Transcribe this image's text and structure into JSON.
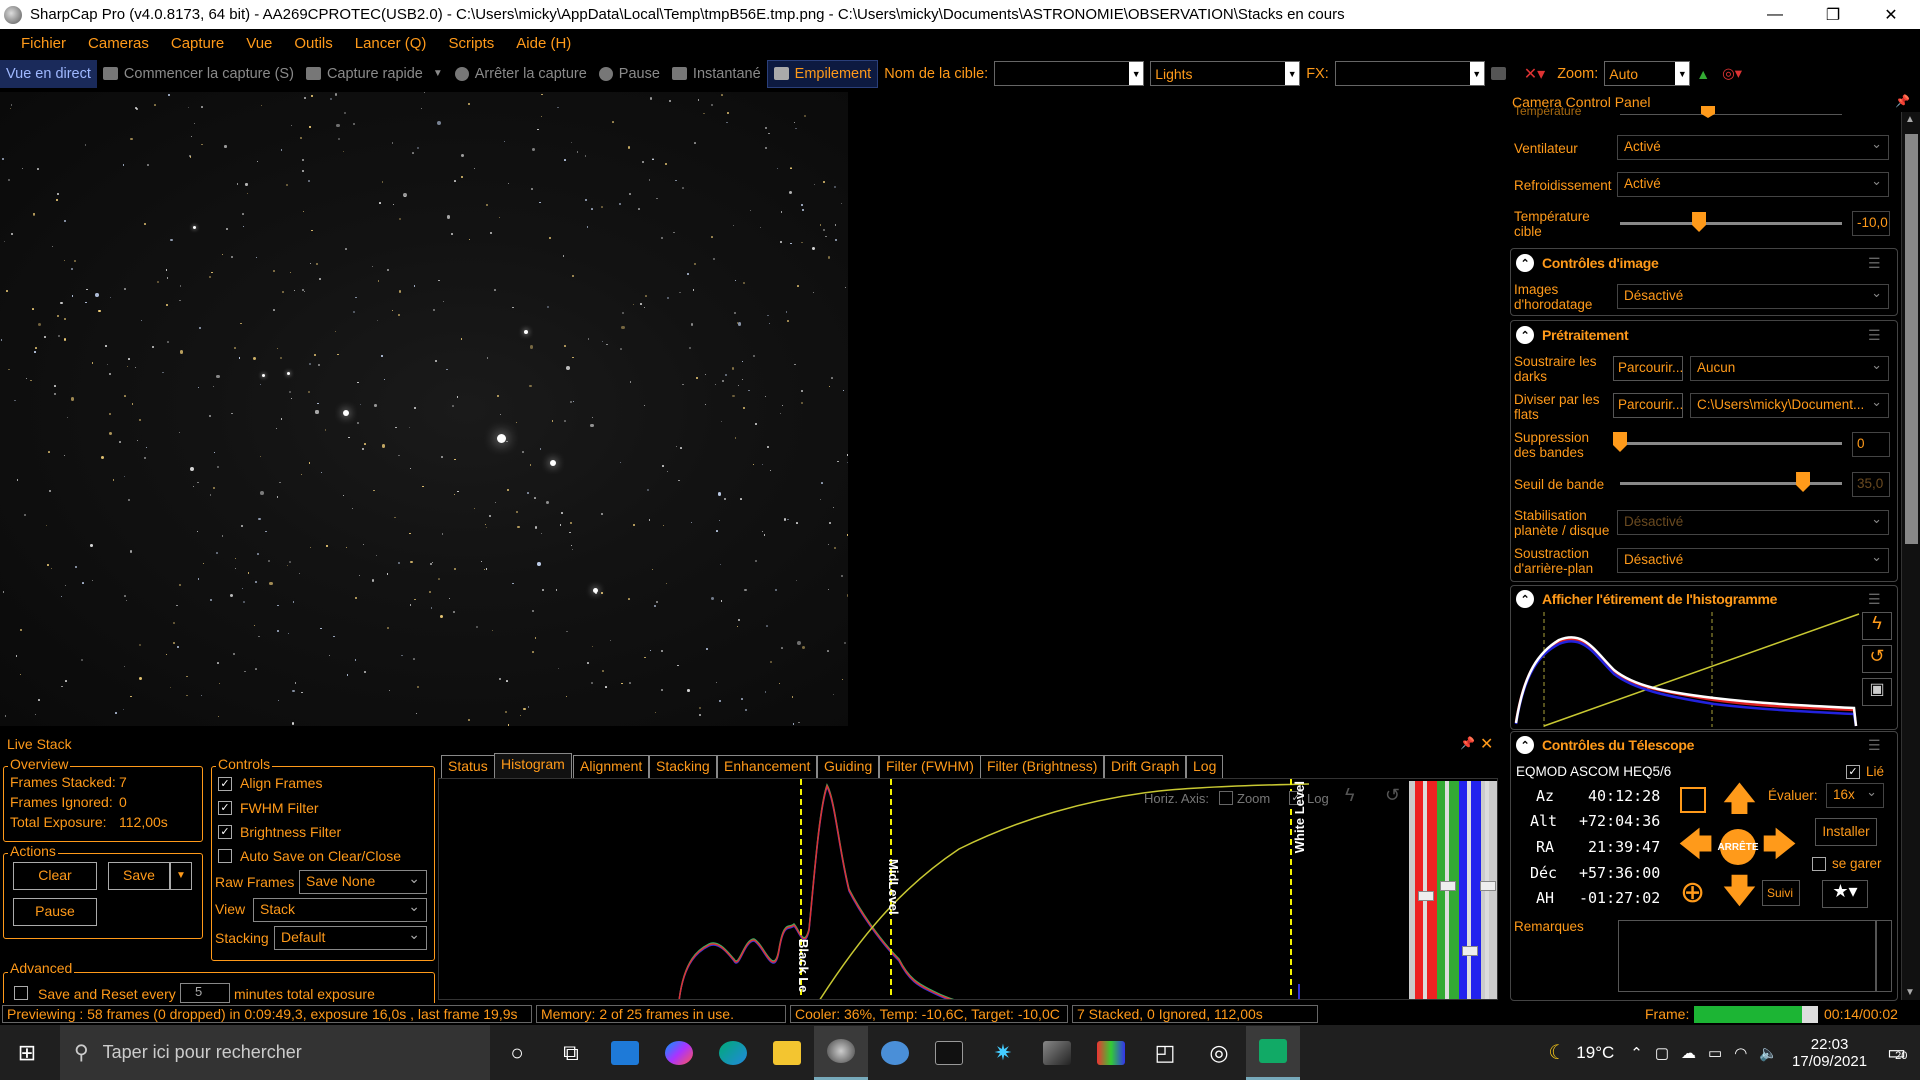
{
  "window": {
    "title": "SharpCap Pro (v4.0.8173, 64 bit) - AA269CPROTEC(USB2.0) - C:\\Users\\micky\\AppData\\Local\\Temp\\tmpB56E.tmp.png - C:\\Users\\micky\\Documents\\ASTRONOMIE\\OBSERVATION\\Stacks en cours",
    "minimize": "—",
    "restore": "❐",
    "close": "✕"
  },
  "menu": [
    "Fichier",
    "Cameras",
    "Capture",
    "Vue",
    "Outils",
    "Lancer (Q)",
    "Scripts",
    "Aide (H)"
  ],
  "toolbar": {
    "live_view": "Vue en direct",
    "start_capture": "Commencer la capture (S)",
    "quick_capture": "Capture rapide",
    "stop_capture": "Arrêter la capture",
    "pause": "Pause",
    "snapshot": "Instantané",
    "stacking": "Empilement",
    "target_label": "Nom de la cible:",
    "target_value": "",
    "frame_type": "Lights",
    "fx_label": "FX:",
    "fx_value": "",
    "zoom_label": "Zoom:",
    "zoom_value": "Auto"
  },
  "camera_panel": {
    "title": "Camera Control Panel",
    "temperature_label": "Température",
    "fan_label": "Ventilateur",
    "fan_value": "Activé",
    "cooling_label": "Refroidissement",
    "cooling_value": "Activé",
    "target_temp_label_1": "Température",
    "target_temp_label_2": "cible",
    "target_temp_value": "-10,0",
    "target_temp_level": 0.38,
    "image_controls": {
      "title": "Contrôles d'image",
      "timestamp_label_1": "Images",
      "timestamp_label_2": "d'horodatage",
      "timestamp_value": "Désactivé"
    },
    "preprocessing": {
      "title": "Prétraitement",
      "darks_label_1": "Soustraire les",
      "darks_label_2": "darks",
      "darks_browse": "Parcourir...",
      "darks_value": "Aucun",
      "flats_label_1": "Diviser par les",
      "flats_label_2": "flats",
      "flats_browse": "Parcourir...",
      "flats_value": "C:\\Users\\micky\\Document...",
      "banding_label_1": "Suppression",
      "banding_label_2": "des bandes",
      "banding_value": "0",
      "banding_level": 0.0,
      "band_threshold_label": "Seuil de bande",
      "band_threshold_value": "35,0",
      "band_threshold_level": 0.88,
      "stabilization_label_1": "Stabilisation",
      "stabilization_label_2": "planète / disque",
      "stabilization_value": "Désactivé",
      "background_label_1": "Soustraction",
      "background_label_2": "d'arrière-plan",
      "background_value": "Désactivé"
    },
    "histogram_stretch": {
      "title": "Afficher l'étirement de l'histogramme"
    },
    "telescope": {
      "title": "Contrôles du Télescope",
      "mount": "EQMOD ASCOM HEQ5/6",
      "linked_label": "Lié",
      "az_label": "Az",
      "az_value": "40:12:28",
      "alt_label": "Alt",
      "alt_value": "+72:04:36",
      "ra_label": "RA",
      "ra_value": "21:39:47",
      "dec_label": "Déc",
      "dec_value": "+57:36:00",
      "ha_label": "AH",
      "ha_value": "-01:27:02",
      "stop_label": "ARRÊTE",
      "rate_label": "Évaluer:",
      "rate_value": "16x",
      "install_button": "Installer",
      "park_label": "se garer",
      "track_button": "Suivi",
      "remarks_label": "Remarques"
    }
  },
  "live_stack": {
    "title": "Live Stack",
    "overview": {
      "legend": "Overview",
      "frames_stacked_label": "Frames Stacked:",
      "frames_stacked": "7",
      "frames_ignored_label": "Frames Ignored:",
      "frames_ignored": "0",
      "total_exposure_label": "Total Exposure:",
      "total_exposure": "112,00s"
    },
    "actions": {
      "legend": "Actions",
      "clear": "Clear",
      "save": "Save",
      "pause": "Pause"
    },
    "advanced": {
      "legend": "Advanced",
      "save_reset_label": "Save and Reset every",
      "minutes_value": "5",
      "minutes_label": "minutes total exposure"
    },
    "controls": {
      "legend": "Controls",
      "align_frames": "Align Frames",
      "fwhm_filter": "FWHM Filter",
      "brightness_filter": "Brightness Filter",
      "auto_save": "Auto Save on Clear/Close",
      "raw_frames_label": "Raw Frames",
      "raw_frames_value": "Save None",
      "view_label": "View",
      "view_value": "Stack",
      "stacking_label": "Stacking",
      "stacking_value": "Default"
    },
    "tabs": [
      "Status",
      "Histogram",
      "Alignment",
      "Stacking",
      "Enhancement",
      "Guiding",
      "Filter (FWHM)",
      "Filter (Brightness)",
      "Drift Graph",
      "Log"
    ],
    "active_tab": "Histogram",
    "histogram": {
      "horiz_axis_label": "Horiz. Axis:",
      "zoom_label": "Zoom",
      "log_label": "Log",
      "black_level_label": "Black Le",
      "mid_level_label": "MidLevel",
      "white_level_label": "White Level"
    }
  },
  "status_bar": {
    "preview": "Previewing : 58 frames (0 dropped) in 0:09:49,3, exposure 16,0s , last frame 19,9s",
    "memory": "Memory: 2 of 25 frames in use.",
    "cooler": "Cooler: 36%, Temp: -10,6C, Target: -10,0C",
    "stack": "7 Stacked, 0 Ignored, 112,00s",
    "frame_label": "Frame:",
    "frame_progress": 0.87,
    "frame_time": "00:14/00:02"
  },
  "taskbar": {
    "search_placeholder": "Taper ici pour rechercher",
    "temperature": "19°C",
    "time": "22:03",
    "date": "17/09/2021",
    "notifications": "20"
  },
  "colors": {
    "accent": "#ff9a1a",
    "background": "#000000",
    "taskbar": "#1f1f1f"
  }
}
